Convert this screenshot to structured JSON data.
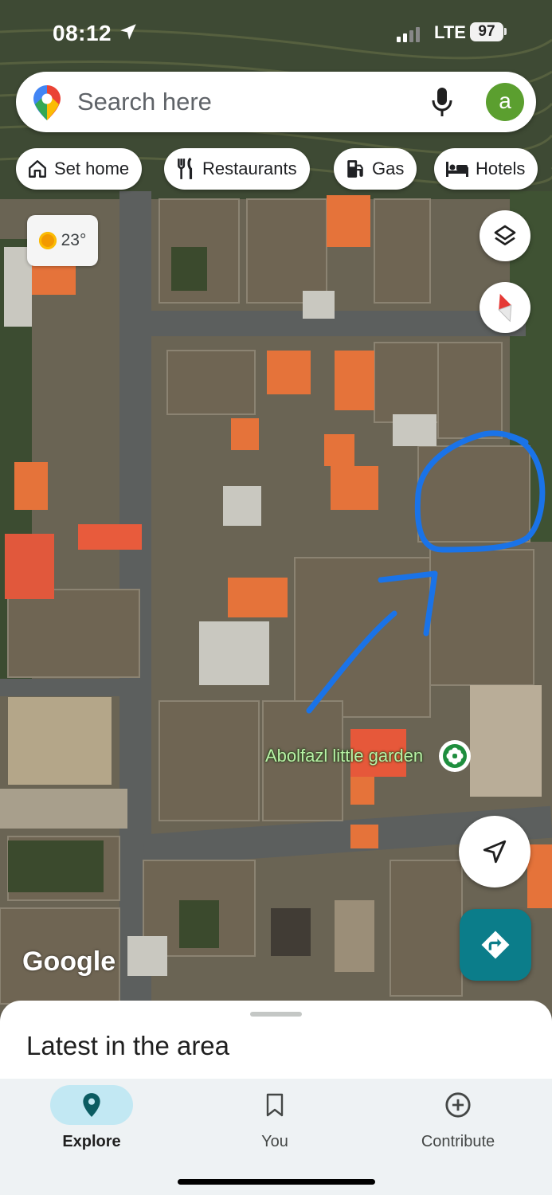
{
  "status_bar": {
    "time": "08:12",
    "network": "LTE",
    "battery": "97"
  },
  "search": {
    "placeholder": "Search here",
    "avatar_letter": "a"
  },
  "chips": [
    {
      "label": "Set home",
      "icon": "home-icon"
    },
    {
      "label": "Restaurants",
      "icon": "restaurant-icon"
    },
    {
      "label": "Gas",
      "icon": "gas-station-icon"
    },
    {
      "label": "Hotels",
      "icon": "hotel-icon"
    }
  ],
  "weather": {
    "temperature": "23°",
    "icon": "sun-icon"
  },
  "map": {
    "place_label": "Abolfazl little garden",
    "place_icon": "flower-icon",
    "logo": "Google",
    "annotation_color": "#1a73e8"
  },
  "sheet": {
    "title": "Latest in the area"
  },
  "bottom_nav": [
    {
      "label": "Explore",
      "icon": "location-pin-icon",
      "active": true
    },
    {
      "label": "You",
      "icon": "bookmark-icon",
      "active": false
    },
    {
      "label": "Contribute",
      "icon": "add-circle-icon",
      "active": false
    }
  ],
  "colors": {
    "accent": "#0b7d8a",
    "active_nav": "#c2e8f3",
    "avatar": "#5b9f2f"
  }
}
